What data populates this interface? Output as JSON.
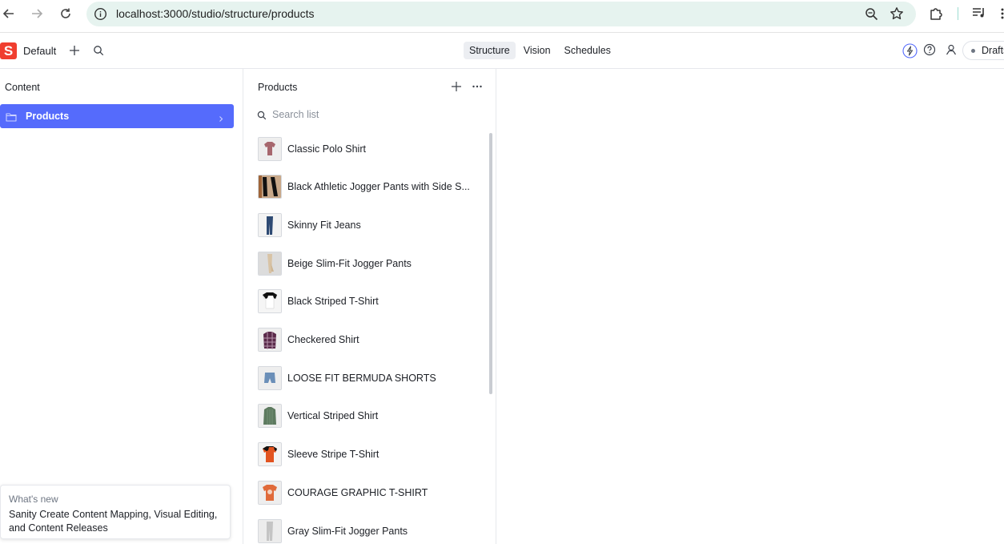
{
  "browser": {
    "url": "localhost:3000/studio/structure/products"
  },
  "navbar": {
    "logo_letter": "S",
    "workspace": "Default",
    "tools": [
      {
        "label": "Structure",
        "active": true
      },
      {
        "label": "Vision",
        "active": false
      },
      {
        "label": "Schedules",
        "active": false
      }
    ],
    "drafts_label": "Drafts"
  },
  "content_pane": {
    "title": "Content",
    "items": [
      {
        "label": "Products",
        "selected": true
      }
    ]
  },
  "whats_new": {
    "title": "What's new",
    "body": "Sanity Create Content Mapping, Visual Editing, and Content Releases"
  },
  "products_pane": {
    "title": "Products",
    "search_placeholder": "Search list",
    "items": [
      {
        "title": "Classic Polo Shirt",
        "thumb": "polo"
      },
      {
        "title": "Black Athletic Jogger Pants with Side S...",
        "thumb": "jogger-black"
      },
      {
        "title": "Skinny Fit Jeans",
        "thumb": "jeans"
      },
      {
        "title": "Beige Slim-Fit Jogger Pants",
        "thumb": "jogger-beige"
      },
      {
        "title": "Black Striped T-Shirt",
        "thumb": "tshirt-bw"
      },
      {
        "title": "Checkered Shirt",
        "thumb": "checkered"
      },
      {
        "title": "LOOSE FIT BERMUDA SHORTS",
        "thumb": "shorts"
      },
      {
        "title": "Vertical Striped Shirt",
        "thumb": "green-shirt"
      },
      {
        "title": "Sleeve Stripe T-Shirt",
        "thumb": "orange-tee"
      },
      {
        "title": "COURAGE GRAPHIC T-SHIRT",
        "thumb": "graphic-tee"
      },
      {
        "title": "Gray Slim-Fit Jogger Pants",
        "thumb": "jogger-gray"
      }
    ]
  },
  "colors": {
    "accent": "#556bfc",
    "logo": "#f03e2f",
    "omnibox": "#e6f3ef"
  }
}
